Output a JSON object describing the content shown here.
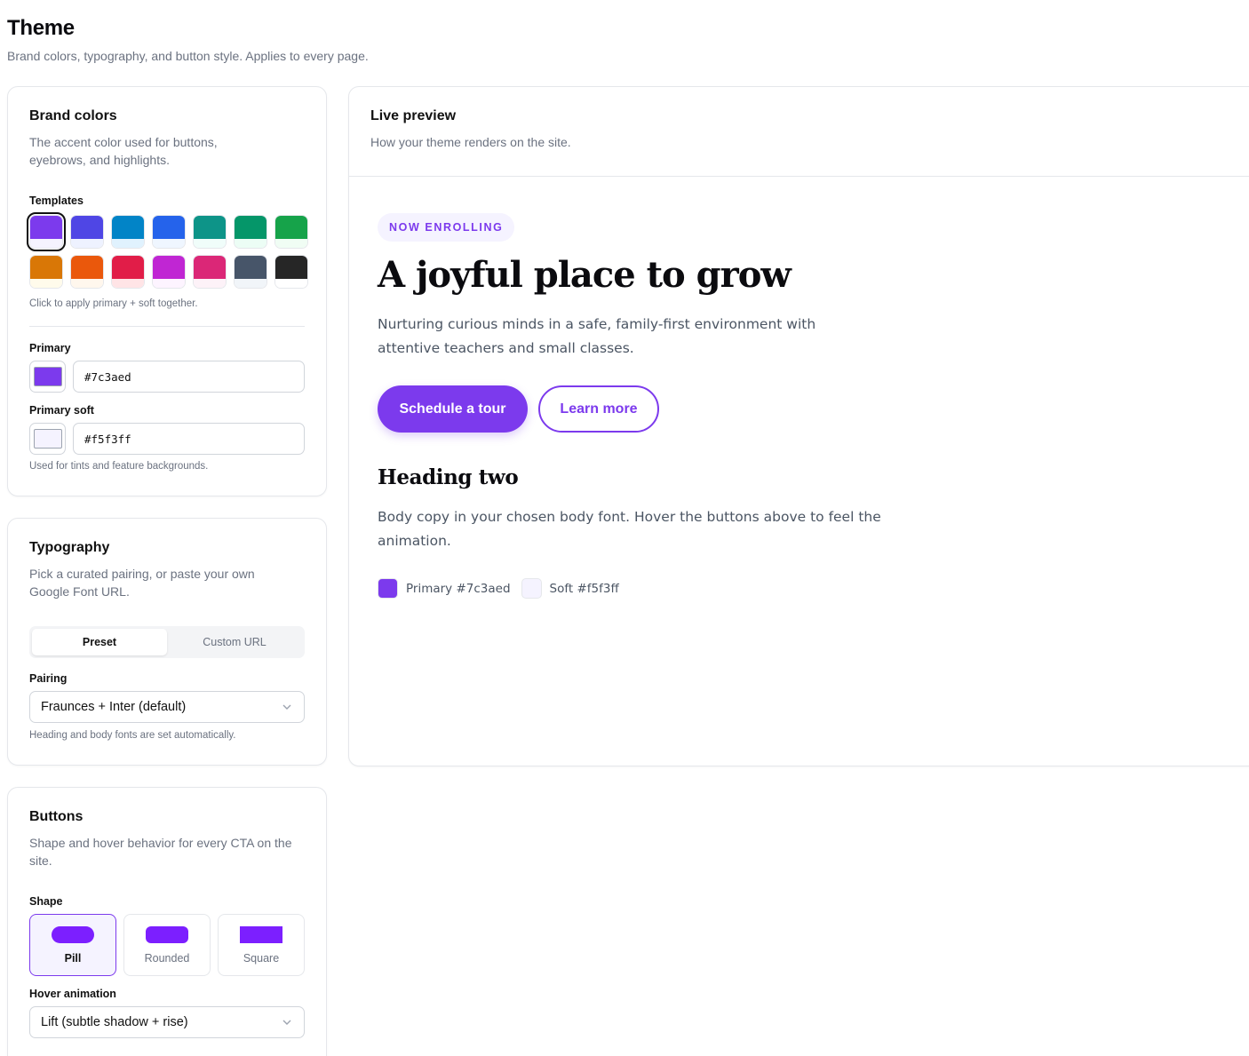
{
  "page": {
    "title": "Theme",
    "subtitle": "Brand colors, typography, and button style. Applies to every page."
  },
  "brand": {
    "title": "Brand colors",
    "desc": "The accent color used for buttons, eyebrows, and highlights.",
    "templates_label": "Templates",
    "templates": [
      {
        "primary": "#7c3aed",
        "soft": "#f5f3ff",
        "selected": true
      },
      {
        "primary": "#4f46e5",
        "soft": "#eef2ff"
      },
      {
        "primary": "#0284c7",
        "soft": "#e0f2fe"
      },
      {
        "primary": "#2563eb",
        "soft": "#eff6ff"
      },
      {
        "primary": "#0d9488",
        "soft": "#f0fdfa"
      },
      {
        "primary": "#059669",
        "soft": "#ecfdf5"
      },
      {
        "primary": "#16a34a",
        "soft": "#f0fdf4"
      },
      {
        "primary": "#d97706",
        "soft": "#fffbeb"
      },
      {
        "primary": "#ea580c",
        "soft": "#fff7ed"
      },
      {
        "primary": "#e11d48",
        "soft": "#ffe4e6"
      },
      {
        "primary": "#c026d3",
        "soft": "#fdf4ff"
      },
      {
        "primary": "#db2777",
        "soft": "#fdf2f8"
      },
      {
        "primary": "#475569",
        "soft": "#f1f5f9"
      },
      {
        "primary": "#262626",
        "soft": "#ffffff"
      }
    ],
    "templates_hint": "Click to apply primary + soft together.",
    "primary_label": "Primary",
    "primary_value": "#7c3aed",
    "primary_soft_label": "Primary soft",
    "primary_soft_value": "#f5f3ff",
    "soft_hint": "Used for tints and feature backgrounds."
  },
  "typography": {
    "title": "Typography",
    "desc": "Pick a curated pairing, or paste your own Google Font URL.",
    "tabs": [
      "Preset",
      "Custom URL"
    ],
    "active_tab": 0,
    "pairing_label": "Pairing",
    "pairing_value": "Fraunces + Inter (default)",
    "pairing_hint": "Heading and body fonts are set automatically."
  },
  "buttons": {
    "title": "Buttons",
    "desc": "Shape and hover behavior for every CTA on the site.",
    "shape_label": "Shape",
    "shapes": [
      "Pill",
      "Rounded",
      "Square"
    ],
    "active_shape": 0,
    "hover_label": "Hover animation",
    "hover_value": "Lift (subtle shadow + rise)"
  },
  "preview": {
    "title": "Live preview",
    "desc": "How your theme renders on the site.",
    "eyebrow": "NOW ENROLLING",
    "hero_title": "A joyful place to grow",
    "hero_body": "Nurturing curious minds in a safe, family-first environment with attentive teachers and small classes.",
    "primary_cta": "Schedule a tour",
    "secondary_cta": "Learn more",
    "h2": "Heading two",
    "body2": "Body copy in your chosen body font. Hover the buttons above to feel the animation.",
    "legend_primary": "Primary #7c3aed",
    "legend_soft": "Soft #f5f3ff"
  },
  "colors": {
    "accent": "#7c3aed",
    "accent_soft": "#f5f3ff"
  }
}
